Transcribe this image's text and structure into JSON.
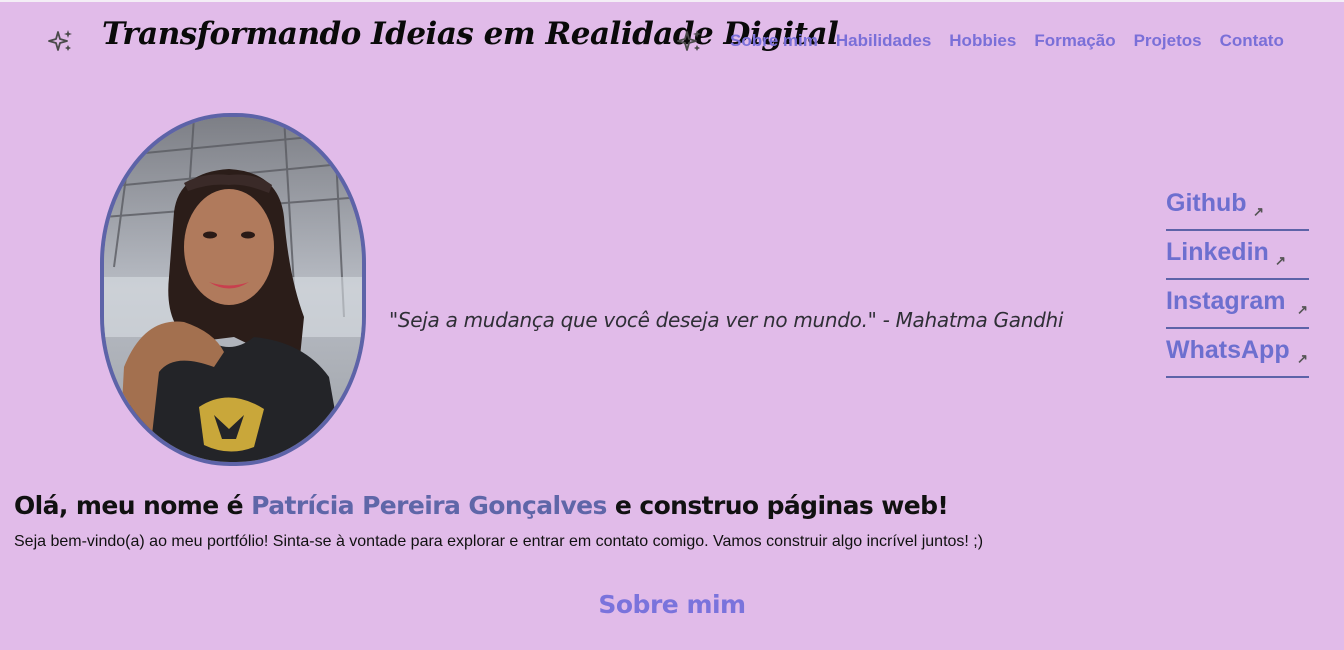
{
  "header": {
    "title": "Transformando Ideias em Realidade Digital",
    "left_icon": "sparkles-icon",
    "right_icon": "sparkles-icon"
  },
  "nav": {
    "items": [
      {
        "label": "Sobre mim"
      },
      {
        "label": "Habilidades"
      },
      {
        "label": "Hobbies"
      },
      {
        "label": "Formação"
      },
      {
        "label": "Projetos"
      },
      {
        "label": "Contato"
      }
    ]
  },
  "hero": {
    "quote": "\"Seja a mudança que você deseja ver no mundo.\" - Mahatma Gandhi",
    "photo_icon": "profile-photo"
  },
  "social": {
    "arrow_glyph": "↗",
    "links": [
      {
        "label": "Github"
      },
      {
        "label": "Linkedin"
      },
      {
        "label": "Instagram"
      },
      {
        "label": "WhatsApp"
      }
    ]
  },
  "intro": {
    "greeting_prefix": "Olá, meu nome é ",
    "name": "Patrícia Pereira Gonçalves",
    "greeting_suffix": " e construo páginas web!",
    "welcome": "Seja bem-vindo(a) ao meu portfólio! Sinta-se à vontade para explorar e entrar em contato comigo. Vamos construir algo incrível juntos! ;)"
  },
  "about_link": "Sobre mim",
  "colors": {
    "background": "#e1bbe9",
    "nav_link": "#7a6fd8",
    "accent_border": "#5d63a8",
    "name_highlight": "#5f66a8"
  }
}
